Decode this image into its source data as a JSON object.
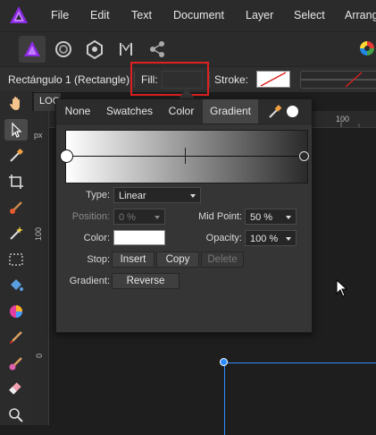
{
  "menubar": {
    "items": [
      "File",
      "Edit",
      "Text",
      "Document",
      "Layer",
      "Select",
      "Arrange"
    ]
  },
  "contextbar": {
    "shape_name": "Rectángulo 1 (Rectangle)",
    "fill_label": "Fill:",
    "stroke_label": "Stroke:"
  },
  "document": {
    "tab_label": "LOC",
    "ruler_unit": "px",
    "ruler_top_numbers": [
      "100"
    ],
    "ruler_left_numbers": [
      "100",
      "0"
    ]
  },
  "fill_popover": {
    "tabs": [
      "None",
      "Swatches",
      "Color",
      "Gradient"
    ],
    "active_tab": "Gradient",
    "type": {
      "label": "Type:",
      "value": "Linear"
    },
    "position": {
      "label": "Position:",
      "value": "0 %"
    },
    "mid_point": {
      "label": "Mid Point:",
      "value": "50 %"
    },
    "color": {
      "label": "Color:",
      "value": "#ffffff"
    },
    "opacity": {
      "label": "Opacity:",
      "value": "100 %"
    },
    "stop": {
      "label": "Stop:",
      "insert": "Insert",
      "copy": "Copy",
      "delete": "Delete"
    },
    "gradient": {
      "label": "Gradient:",
      "reverse": "Reverse"
    }
  },
  "colors": {
    "accent_blue": "#2d8cff",
    "highlight_red": "#e12020"
  }
}
